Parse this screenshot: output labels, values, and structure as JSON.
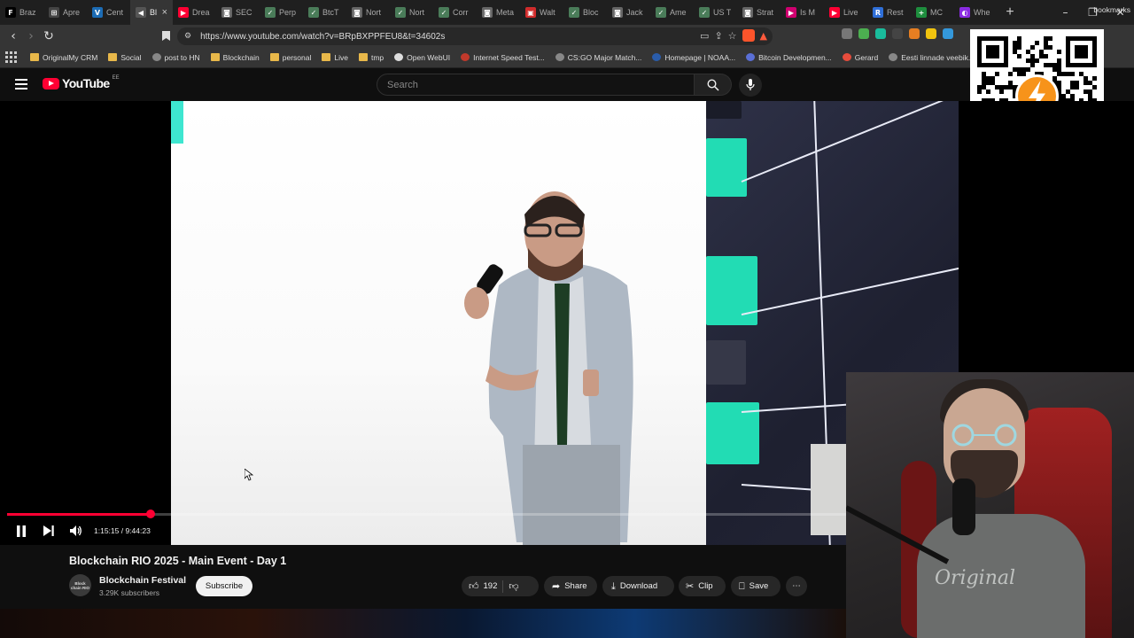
{
  "browser": {
    "tabs": [
      {
        "label": "Braz",
        "color": "#000000",
        "glyph": "F"
      },
      {
        "label": "Apre",
        "color": "#444444",
        "glyph": "⊞"
      },
      {
        "label": "Cent",
        "color": "#1c6cb5",
        "glyph": "V"
      },
      {
        "label": "Bl",
        "color": "#555555",
        "glyph": "◀",
        "active": true
      },
      {
        "label": "Drea",
        "color": "#ff0033",
        "glyph": "▶"
      },
      {
        "label": "SEC",
        "color": "#666666",
        "glyph": "◙"
      },
      {
        "label": "Perp",
        "color": "#4a7c59",
        "glyph": "✓"
      },
      {
        "label": "BtcT",
        "color": "#4a7c59",
        "glyph": "✓"
      },
      {
        "label": "Nort",
        "color": "#666666",
        "glyph": "◙"
      },
      {
        "label": "Nort",
        "color": "#4a7c59",
        "glyph": "✓"
      },
      {
        "label": "Corr",
        "color": "#4a7c59",
        "glyph": "✓"
      },
      {
        "label": "Meta",
        "color": "#666666",
        "glyph": "◙"
      },
      {
        "label": "Walt",
        "color": "#d12c2c",
        "glyph": "▣"
      },
      {
        "label": "Bloc",
        "color": "#4a7c59",
        "glyph": "✓"
      },
      {
        "label": "Jack",
        "color": "#666666",
        "glyph": "◙"
      },
      {
        "label": "Ame",
        "color": "#4a7c59",
        "glyph": "✓"
      },
      {
        "label": "US T",
        "color": "#4a7c59",
        "glyph": "✓"
      },
      {
        "label": "Strat",
        "color": "#666666",
        "glyph": "◙"
      },
      {
        "label": "Is M",
        "color": "#d0006f",
        "glyph": "▶"
      },
      {
        "label": "Live",
        "color": "#ff0033",
        "glyph": "▶"
      },
      {
        "label": "Rest",
        "color": "#2f6fd8",
        "glyph": "R"
      },
      {
        "label": "MC",
        "color": "#1e8e3e",
        "glyph": "+"
      },
      {
        "label": "Whe",
        "color": "#8a2be2",
        "glyph": "◐"
      }
    ],
    "new_tab_glyph": "+",
    "window_controls": [
      "–",
      "❐",
      "✕"
    ],
    "url": "https://www.youtube.com/watch?v=BRpBXPPFEU8&t=34602s",
    "bookmarks": [
      {
        "label": "OriginalMy CRM",
        "type": "folder"
      },
      {
        "label": "Social",
        "type": "folder"
      },
      {
        "label": "post to HN",
        "type": "site",
        "color": "#888888"
      },
      {
        "label": "Blockchain",
        "type": "folder"
      },
      {
        "label": "personal",
        "type": "folder"
      },
      {
        "label": "Live",
        "type": "folder"
      },
      {
        "label": "tmp",
        "type": "folder"
      },
      {
        "label": "Open WebUI",
        "type": "site",
        "color": "#dddddd"
      },
      {
        "label": "Internet Speed Test...",
        "type": "site",
        "color": "#c0392b"
      },
      {
        "label": "CS:GO Major Match...",
        "type": "site",
        "color": "#888888"
      },
      {
        "label": "Homepage | NOAA...",
        "type": "site",
        "color": "#2a5caa"
      },
      {
        "label": "Bitcoin Developmen...",
        "type": "site",
        "color": "#5a6fd6"
      },
      {
        "label": "Gerard",
        "type": "site",
        "color": "#e74c3c"
      },
      {
        "label": "Eesti linnade veebik...",
        "type": "site",
        "color": "#888888"
      }
    ],
    "bookmarks_end": "bookmarks"
  },
  "youtube": {
    "logo_text": "YouTube",
    "country": "EE",
    "search_placeholder": "Search"
  },
  "player": {
    "current_time": "1:15:15",
    "duration": "9:44:23",
    "timecode": "1:15:15 / 9:44:23",
    "progress_fraction": 0.1287,
    "shirt_text": "Original"
  },
  "video": {
    "title": "Blockchain RIO 2025 - Main Event - Day 1",
    "channel_name": "Blockchain Festival",
    "channel_avatar_text": "Block chain RIO",
    "subscribers": "3.29K subscribers",
    "subscribe_label": "Subscribe",
    "likes": "192",
    "share_label": "Share",
    "download_label": "Download",
    "clip_label": "Clip",
    "save_label": "Save",
    "more_glyph": "⋯"
  },
  "colors": {
    "accent": "#ff0033",
    "background": "#0f0f0f",
    "qr_badge": "#f7931a"
  }
}
